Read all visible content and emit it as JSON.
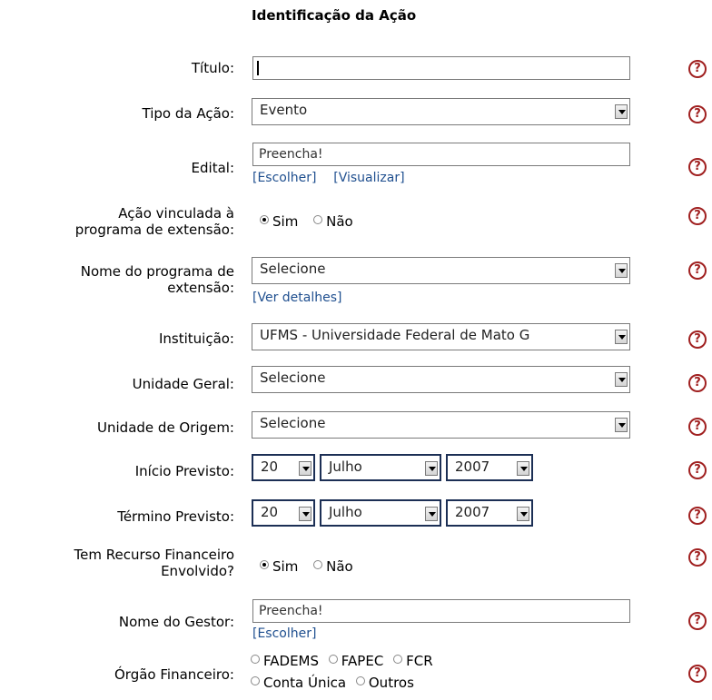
{
  "header": {
    "title": "Identificação da Ação"
  },
  "labels": {
    "titulo": "Título:",
    "tipo": "Tipo da Ação:",
    "edital": "Edital:",
    "acao_vinculada_1": "Ação vinculada à",
    "acao_vinculada_2": "programa de extensão:",
    "nome_programa_1": "Nome do programa de",
    "nome_programa_2": "extensão:",
    "instituicao": "Instituição:",
    "unidade_geral": "Unidade Geral:",
    "unidade_origem": "Unidade de Origem:",
    "inicio": "Início Previsto:",
    "termino": "Término Previsto:",
    "recurso_1": "Tem Recurso Financeiro",
    "recurso_2": "Envolvido?",
    "gestor": "Nome do Gestor:",
    "orgao": "Órgão Financeiro:"
  },
  "fields": {
    "titulo_value": "",
    "tipo_selected": "Evento",
    "edital_value": "Preencha!",
    "edital_escolher": "[Escolher]",
    "edital_visualizar": "[Visualizar]",
    "programa_selected": "Selecione",
    "ver_detalhes": "[Ver detalhes]",
    "instituicao_selected": "UFMS - Universidade Federal de Mato G",
    "unidade_geral_selected": "Selecione",
    "unidade_origem_selected": "Selecione",
    "inicio": {
      "dia": "20",
      "mes": "Julho",
      "ano": "2007"
    },
    "termino": {
      "dia": "20",
      "mes": "Julho",
      "ano": "2007"
    },
    "gestor_value": "Preencha!",
    "gestor_escolher": "[Escolher]"
  },
  "radios": {
    "sim": "Sim",
    "nao": "Não",
    "acao_vinculada_selected": "Sim",
    "recurso_selected": "Sim",
    "orgaos": [
      "FADEMS",
      "FAPEC",
      "FCR",
      "Conta Única",
      "Outros"
    ]
  },
  "help_icon": {
    "glyph": "?",
    "icon": "question-circle-icon",
    "color": "#a02020"
  }
}
